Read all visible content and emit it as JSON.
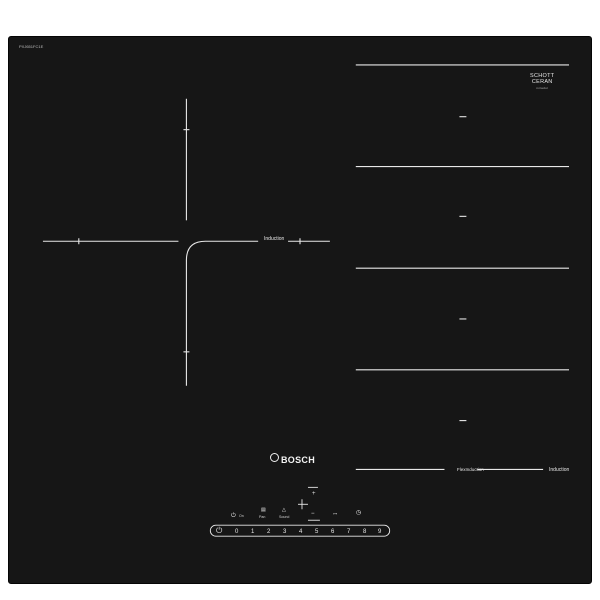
{
  "model_number": "PXJ651FC1E",
  "glass_brand": {
    "line1": "SCHOTT",
    "line2": "CERAN",
    "line3": "miradur"
  },
  "brand_name": "BOSCH",
  "zone_labels": {
    "left": "Induction",
    "right": "Induction",
    "flex": "FlexInduction"
  },
  "controls": {
    "power_label": "On",
    "pan_label": "Pan",
    "sound_label": "Sound",
    "plus": "+",
    "minus": "−",
    "scale": [
      "0",
      "1",
      "2",
      "3",
      "4",
      "5",
      "6",
      "7",
      "8",
      "9"
    ],
    "power_icon": "power-icon",
    "timer_icon": "timer-icon",
    "childlock_icon": "key-icon"
  },
  "colors": {
    "glass": "#161616",
    "markings": "#e8e8e8",
    "frame": "#050505"
  }
}
